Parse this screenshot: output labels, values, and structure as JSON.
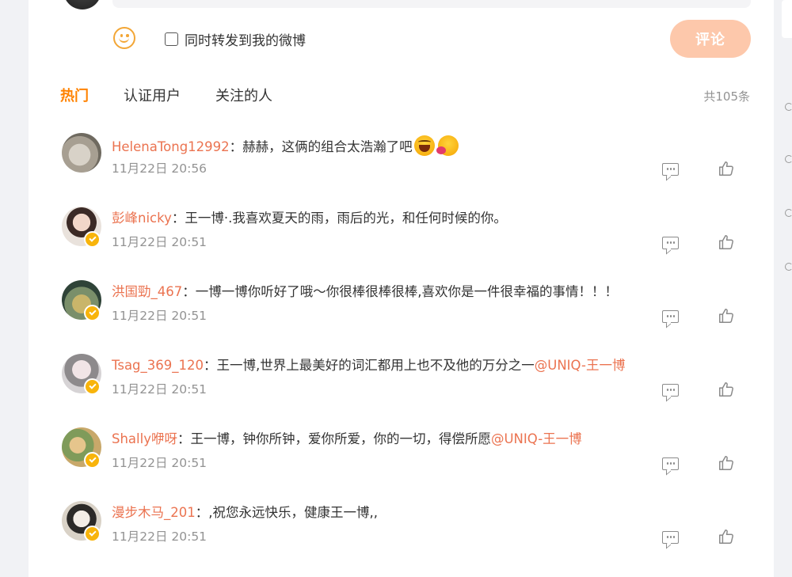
{
  "composer": {
    "repost_label": "同时转发到我的微博",
    "submit_label": "评论"
  },
  "tabs": [
    {
      "label": "热门",
      "active": true
    },
    {
      "label": "认证用户",
      "active": false
    },
    {
      "label": "关注的人",
      "active": false
    }
  ],
  "comment_count": "共105条",
  "colors": {
    "accent": "#ff8200",
    "username": "#eb7350",
    "submit_bg": "#fdc8ab",
    "verified_badge": "#f8b40b"
  },
  "comments": [
    {
      "user": "HelenaTong12992",
      "sep": "：",
      "text": "赫赫，这俩的组合太浩瀚了吧",
      "mention": "",
      "emojis": [
        "laugh-emoji",
        "thinking-emoji"
      ],
      "time": "11月22日 20:56",
      "verified": false
    },
    {
      "user": "彭峰nicky",
      "sep": "：",
      "text": "王一博·.我喜欢夏天的雨，雨后的光，和任何时候的你。",
      "mention": "",
      "time": "11月22日 20:51",
      "verified": true
    },
    {
      "user": "洪国勁_467",
      "sep": "：",
      "text": "一博一博你听好了哦～你很棒很棒很棒,喜欢你是一件很幸福的事情！！！",
      "mention": "",
      "time": "11月22日 20:51",
      "verified": true
    },
    {
      "user": "Tsag_369_120",
      "sep": "：",
      "text": "王一博,世界上最美好的词汇都用上也不及他的万分之一",
      "mention": "@UNIQ-王一博",
      "time": "11月22日 20:51",
      "verified": true
    },
    {
      "user": "Shally咿呀",
      "sep": "：",
      "text": "王一博，钟你所钟，爱你所爱，你的一切，得偿所愿",
      "mention": "@UNIQ-王一博",
      "time": "11月22日 20:51",
      "verified": true
    },
    {
      "user": "漫步木马_201",
      "sep": "：",
      "text": ",祝您永远快乐，健康王一博,,",
      "mention": "",
      "time": "11月22日 20:51",
      "verified": true
    }
  ]
}
